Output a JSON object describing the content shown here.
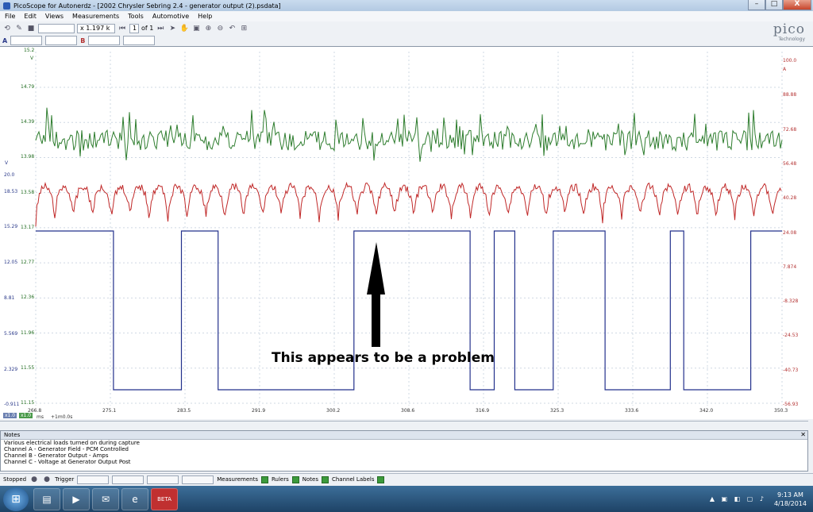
{
  "window": {
    "title": "PicoScope for Autonerdz - [2002 Chrysler Sebring 2.4 - generator output (2).psdata]",
    "controls": [
      "–",
      "□",
      "X"
    ]
  },
  "menu": [
    "File",
    "Edit",
    "Views",
    "Measurements",
    "Tools",
    "Automotive",
    "Help"
  ],
  "toolbar": {
    "zoom_value": "x 1.197 k",
    "page_current": "1",
    "page_of": "of 1",
    "channel_a": "A",
    "channel_b": "B"
  },
  "logo": {
    "name": "pico",
    "sub": "Technology"
  },
  "scope": {
    "green_top_label": "15.2",
    "green_unit": "V",
    "green_ticks": [
      "14.79",
      "14.39",
      "13.98",
      "13.58",
      "13.17",
      "12.77",
      "12.36",
      "11.96",
      "11.55",
      "11.15"
    ],
    "blue_unit": "V",
    "blue_ticks": [
      "20.0",
      "18.53",
      "15.29",
      "12.05",
      "8.81",
      "5.569",
      "2.329",
      "-0.911"
    ],
    "red_ticks": [
      "100.0",
      "88.88",
      "72.68",
      "56.48",
      "40.28",
      "24.08",
      "7.874",
      "-8.328",
      "-24.53",
      "-40.73",
      "-56.93"
    ],
    "red_unit": "A",
    "x_ticks": [
      "266.8",
      "275.1",
      "283.5",
      "291.9",
      "300.2",
      "308.6",
      "316.9",
      "325.3",
      "333.6",
      "342.0",
      "350.3"
    ],
    "x_unit": "ms",
    "x_zoom": "x1.0",
    "x_zoom2": "x1.0",
    "x_offset": "+1m0.0s",
    "annotation": "This appears to be a problem"
  },
  "chart_data": {
    "type": "line",
    "x_unit": "ms",
    "xlim": [
      266.8,
      350.3
    ],
    "series": [
      {
        "channel": "C",
        "unit": "V",
        "pattern": "noisy ripple around ~14.2 V",
        "range": [
          13.9,
          14.6
        ]
      },
      {
        "channel": "B",
        "unit": "A",
        "pattern": "periodic rectified ripple",
        "range": [
          24,
          56
        ]
      },
      {
        "channel": "A",
        "unit": "V",
        "pattern": "square wave (field duty cycle)",
        "high": 15.29,
        "low": 0.0,
        "edges_ms": [
          266.8,
          275.5,
          283.1,
          287.2,
          302.4,
          315.4,
          318.1,
          320.4,
          324.7,
          330.5,
          337.8,
          339.3,
          346.8
        ]
      }
    ]
  },
  "notes": {
    "header": "Notes",
    "lines": [
      "Various electrical loads turned on during capture",
      "Channel A - Generator Field - PCM Controlled",
      "Channel B - Generator Output - Amps",
      "Channel C - Voltage at Generator Output Post"
    ]
  },
  "status": {
    "stopped": "Stopped",
    "trigger": "Trigger",
    "measurements": "Measurements",
    "rulers": "Rulers",
    "notes": "Notes",
    "channel_labels": "Channel Labels"
  },
  "taskbar": {
    "time": "9:13 AM",
    "date": "4/18/2014",
    "beta": "BETA"
  }
}
